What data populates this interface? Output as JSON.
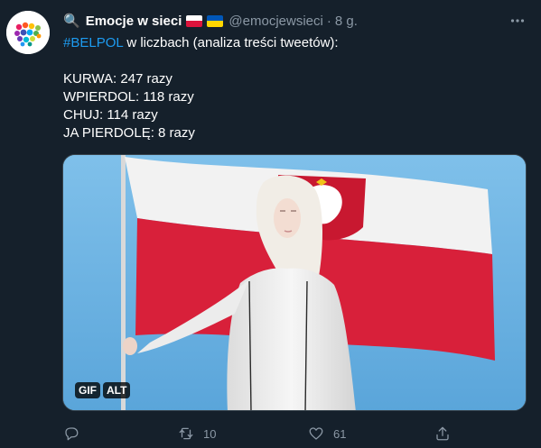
{
  "tweet": {
    "display_name": "Emocje w sieci",
    "header_emoji": "🔍",
    "flags": [
      "flag-poland",
      "flag-ukraine"
    ],
    "handle": "@emocjewsieci",
    "separator": "·",
    "time": "8 g.",
    "text": {
      "hashtag": "#BELPOL",
      "intro": " w liczbach (analiza treści tweetów):",
      "lines": [
        "KURWA: 247 razy",
        "WPIERDOL: 118 razy",
        "CHUJ: 114 razy",
        "JA PIERDOLĘ: 8 razy"
      ]
    },
    "media": {
      "badges": [
        "GIF",
        "ALT"
      ]
    },
    "actions": {
      "reply_count": "",
      "retweet_count": "10",
      "like_count": "61"
    }
  },
  "colors": {
    "background": "#15202b",
    "accent": "#1d9bf0",
    "secondary_text": "#8b98a5",
    "border": "#38444d",
    "poland_white": "#ffffff",
    "poland_red": "#dc143c",
    "ukraine_blue": "#0057b7",
    "ukraine_yellow": "#ffd700"
  }
}
